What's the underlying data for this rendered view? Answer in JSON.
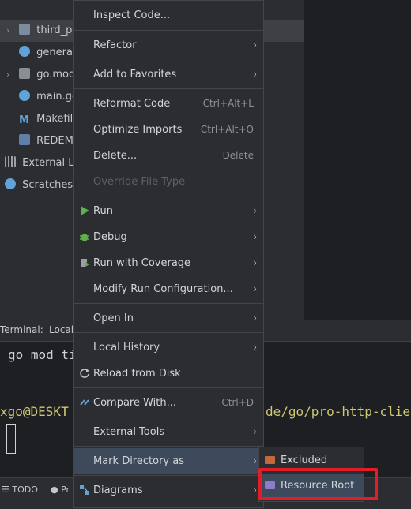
{
  "project_tree": [
    {
      "label": "third_par",
      "chevron": "›",
      "icon": "folder-icon",
      "selected": true
    },
    {
      "label": "generate",
      "icon": "go-file-icon"
    },
    {
      "label": "go.mod",
      "chevron": "›",
      "icon": "go-mod-icon"
    },
    {
      "label": "main.go",
      "icon": "go-file-icon"
    },
    {
      "label": "Makefile",
      "icon": "makefile-icon"
    },
    {
      "label": "REDEME",
      "icon": "readme-icon"
    },
    {
      "label": "External Lib",
      "icon": "external-libraries-icon"
    },
    {
      "label": "Scratches an",
      "icon": "scratches-icon"
    }
  ],
  "terminal": {
    "tab_label": "Terminal:",
    "local_tab": "Local",
    "line1": "go mod ti",
    "line2_prompt": "xgo@DESKT",
    "line2_path": "de/go/pro-http-clie"
  },
  "bottom_bar": {
    "todo": "TODO",
    "problems": "Pr"
  },
  "menu": [
    {
      "label": "Inspect Code...",
      "name": "inspect-code"
    },
    {
      "label": "Refactor",
      "submenu": true,
      "name": "refactor"
    },
    {
      "label": "Add to Favorites",
      "submenu": true,
      "name": "add-to-favorites"
    },
    {
      "label": "Reformat Code",
      "shortcut": "Ctrl+Alt+L",
      "name": "reformat-code"
    },
    {
      "label": "Optimize Imports",
      "shortcut": "Ctrl+Alt+O",
      "name": "optimize-imports"
    },
    {
      "label": "Delete...",
      "shortcut": "Delete",
      "name": "delete"
    },
    {
      "label": "Override File Type",
      "disabled": true,
      "name": "override-file-type"
    },
    {
      "label": "Run",
      "submenu": true,
      "icon": "run-icon",
      "name": "run"
    },
    {
      "label": "Debug",
      "submenu": true,
      "icon": "debug-icon",
      "name": "debug"
    },
    {
      "label": "Run with Coverage",
      "submenu": true,
      "icon": "coverage-icon",
      "name": "run-with-coverage"
    },
    {
      "label": "Modify Run Configuration...",
      "submenu": true,
      "name": "modify-run-configuration"
    },
    {
      "label": "Open In",
      "submenu": true,
      "name": "open-in"
    },
    {
      "label": "Local History",
      "submenu": true,
      "name": "local-history"
    },
    {
      "label": "Reload from Disk",
      "icon": "reload-icon",
      "name": "reload-from-disk"
    },
    {
      "label": "Compare With...",
      "shortcut": "Ctrl+D",
      "icon": "compare-icon",
      "name": "compare-with"
    },
    {
      "label": "External Tools",
      "submenu": true,
      "name": "external-tools"
    },
    {
      "label": "Mark Directory as",
      "submenu": true,
      "active": true,
      "name": "mark-directory-as"
    },
    {
      "label": "Diagrams",
      "submenu": true,
      "icon": "diagrams-icon",
      "name": "diagrams"
    }
  ],
  "submenu": [
    {
      "label": "Excluded",
      "color": "#c06a3c",
      "name": "excluded"
    },
    {
      "label": "Resource Root",
      "color": "#8d7cc9",
      "active": true,
      "name": "resource-root"
    }
  ],
  "colors": {
    "highlight": "#e21d27",
    "menu_active": "#3d4a5b",
    "run_green": "#5fb04f"
  }
}
